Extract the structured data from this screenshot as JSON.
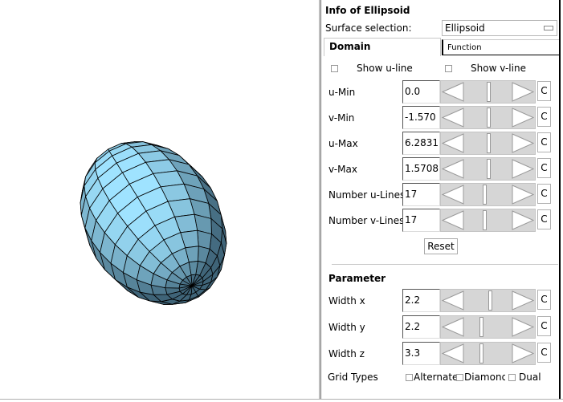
{
  "viewer": {
    "surface": "ellipsoid",
    "fill_light": "#9fe3ff",
    "fill_dark": "#3f6478",
    "edge_color": "#000000",
    "u_lines": 17,
    "v_lines": 17
  },
  "panel": {
    "title": "Info of Ellipsoid",
    "surface_selection_label": "Surface selection:",
    "surface_selection_value": "Ellipsoid",
    "tabs": [
      {
        "label": "Domain",
        "active": true
      },
      {
        "label": "Function",
        "active": false
      }
    ],
    "show_u_line": {
      "label": "Show u-line",
      "checked": false
    },
    "show_v_line": {
      "label": "Show v-line",
      "checked": false
    },
    "domain_rows": [
      {
        "label": "u-Min",
        "value": "0.0",
        "slider_fraction": 0.48,
        "button": "C"
      },
      {
        "label": "v-Min",
        "value": "-1.570",
        "slider_fraction": 0.48,
        "button": "C"
      },
      {
        "label": "u-Max",
        "value": "6.2831",
        "slider_fraction": 0.48,
        "button": "C"
      },
      {
        "label": "v-Max",
        "value": "1.5708",
        "slider_fraction": 0.48,
        "button": "C"
      },
      {
        "label": "Number u-Lines",
        "value": "17",
        "slider_fraction": 0.4,
        "button": "C"
      },
      {
        "label": "Number v-Lines",
        "value": "17",
        "slider_fraction": 0.4,
        "button": "C"
      }
    ],
    "reset_label": "Reset",
    "parameter_title": "Parameter",
    "parameter_rows": [
      {
        "label": "Width x",
        "value": "2.2",
        "slider_fraction": 0.52,
        "button": "C"
      },
      {
        "label": "Width y",
        "value": "2.2",
        "slider_fraction": 0.33,
        "button": "C"
      },
      {
        "label": "Width z",
        "value": "3.3",
        "slider_fraction": 0.33,
        "button": "C"
      }
    ],
    "grid_types_label": "Grid Types",
    "grid_types": [
      {
        "label": "Alternate",
        "checked": false
      },
      {
        "label": "Diamond",
        "checked": false
      },
      {
        "label": "Dual",
        "checked": false
      }
    ]
  }
}
